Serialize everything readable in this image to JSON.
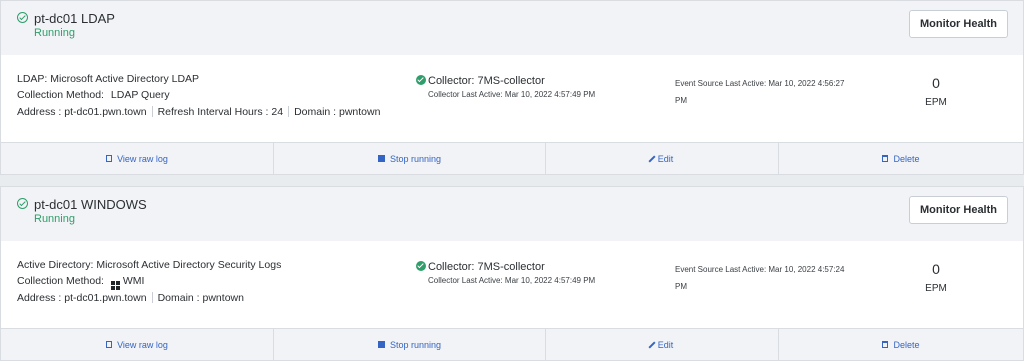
{
  "sources": [
    {
      "title": "pt-dc01 LDAP",
      "status": "Running",
      "monitor_label": "Monitor Health",
      "type_line": "LDAP: Microsoft Active Directory LDAP",
      "method_label": "Collection Method:",
      "method_value": "LDAP Query",
      "method_icon": "",
      "address": "Address : pt-dc01.pwn.town",
      "refresh": "Refresh Interval Hours : 24",
      "domain": "Domain : pwntown",
      "collector": "Collector: 7MS-collector",
      "collector_last": "Collector Last Active: Mar 10, 2022 4:57:49 PM",
      "event_last": "Event Source Last Active: Mar 10, 2022 4:56:27 PM",
      "epm_value": "0",
      "epm_label": "EPM"
    },
    {
      "title": "pt-dc01 WINDOWS",
      "status": "Running",
      "monitor_label": "Monitor Health",
      "type_line": "Active Directory: Microsoft Active Directory Security Logs",
      "method_label": "Collection Method:",
      "method_value": "WMI",
      "method_icon": "windows-icon",
      "address": "Address : pt-dc01.pwn.town",
      "refresh": "",
      "domain": "Domain : pwntown",
      "collector": "Collector: 7MS-collector",
      "collector_last": "Collector Last Active: Mar 10, 2022 4:57:49 PM",
      "event_last": "Event Source Last Active: Mar 10, 2022 4:57:24 PM",
      "epm_value": "0",
      "epm_label": "EPM"
    }
  ],
  "actions": {
    "view_raw_log": "View raw log",
    "stop_running": "Stop running",
    "edit": "Edit",
    "delete": "Delete"
  },
  "colors": {
    "running": "#2f9e6a",
    "action_link": "#3565c4",
    "header_bg": "#f1f3f6"
  }
}
